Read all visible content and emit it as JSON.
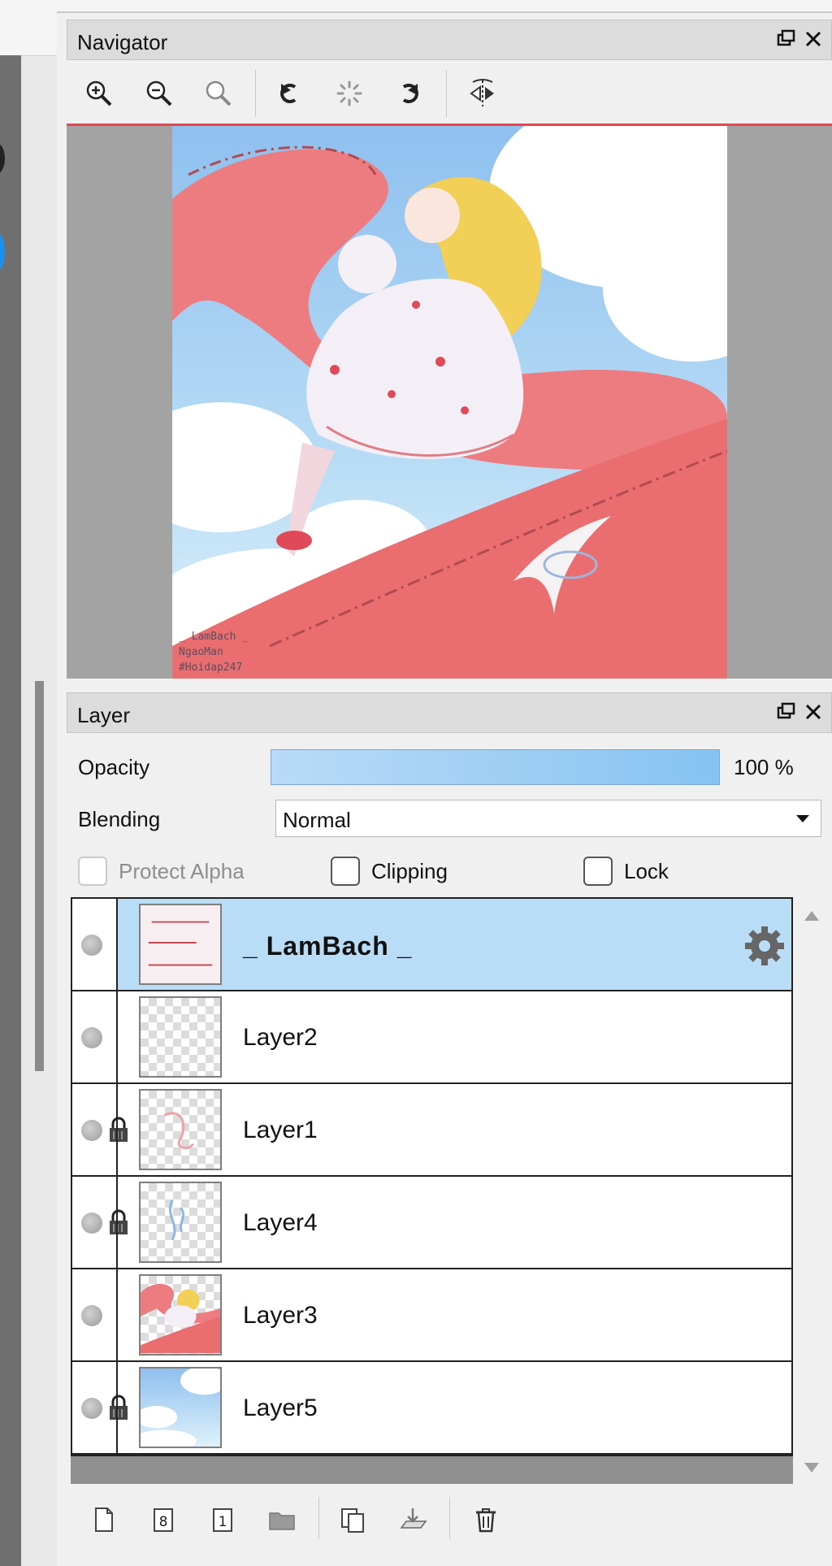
{
  "navigator": {
    "title": "Navigator",
    "tools": [
      "zoom-in-icon",
      "zoom-out-icon",
      "zoom-fit-icon",
      "rotate-left-icon",
      "reset-rotation-icon",
      "rotate-right-icon",
      "flip-horizontal-icon"
    ],
    "watermark": [
      "_ LamBach _",
      "NgaoMan",
      "#Hoidap247"
    ]
  },
  "layer_panel": {
    "title": "Layer",
    "opacity_label": "Opacity",
    "opacity_value": "100 %",
    "opacity_fraction": 1.0,
    "blending_label": "Blending",
    "blending_value": "Normal",
    "protect_alpha_label": "Protect Alpha",
    "clipping_label": "Clipping",
    "lock_label": "Lock",
    "layers": [
      {
        "name": "_ LamBach _",
        "selected": true,
        "locked": false
      },
      {
        "name": "Layer2",
        "selected": false,
        "locked": false
      },
      {
        "name": "Layer1",
        "selected": false,
        "locked": true
      },
      {
        "name": "Layer4",
        "selected": false,
        "locked": true
      },
      {
        "name": "Layer3",
        "selected": false,
        "locked": false
      },
      {
        "name": "Layer5",
        "selected": false,
        "locked": true
      }
    ],
    "bottom_tools": [
      "new-layer-icon",
      "new-8bit-layer-icon",
      "new-1bit-layer-icon",
      "new-folder-icon",
      "duplicate-layer-icon",
      "merge-down-icon",
      "delete-layer-icon"
    ]
  },
  "colors": {
    "accent_red": "#e2474f",
    "selected_row": "#b9ddf7",
    "opacity_fill": "#86c3f2"
  }
}
